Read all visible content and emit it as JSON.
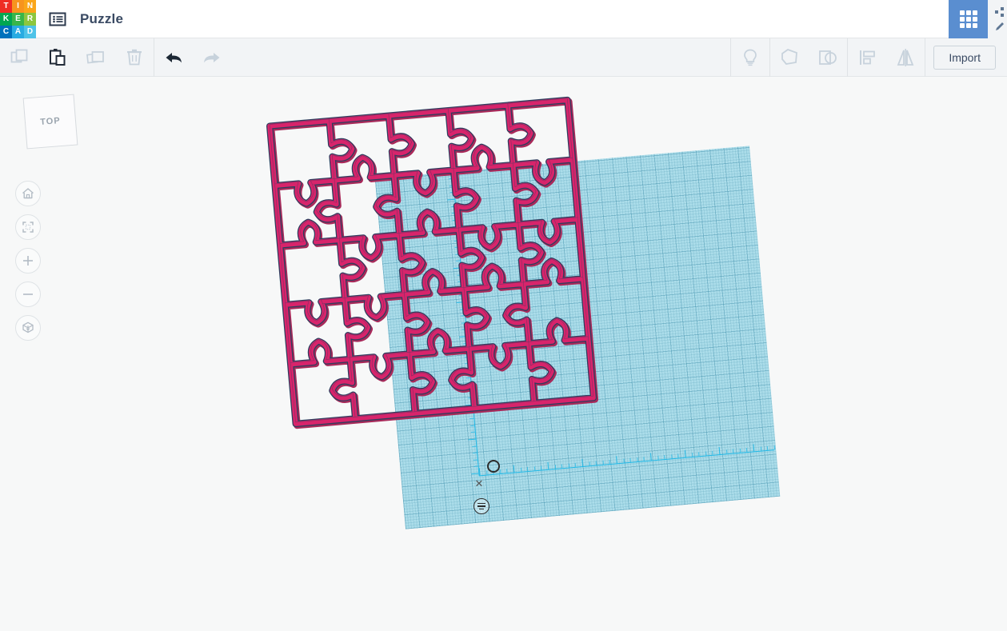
{
  "app": {
    "name": "Tinkercad",
    "logo_letters": [
      {
        "ch": "T",
        "color": "#ee2d24"
      },
      {
        "ch": "I",
        "color": "#f7941e"
      },
      {
        "ch": "N",
        "color": "#faa61a"
      },
      {
        "ch": "K",
        "color": "#00a651"
      },
      {
        "ch": "E",
        "color": "#39b54a"
      },
      {
        "ch": "R",
        "color": "#8dc63f"
      },
      {
        "ch": "C",
        "color": "#0071bc"
      },
      {
        "ch": "A",
        "color": "#29abe2"
      },
      {
        "ch": "D",
        "color": "#4fc3e8"
      }
    ],
    "accent_blue": "#5a8ed0"
  },
  "header": {
    "doc_menu_icon": "list-document-icon",
    "title": "Puzzle",
    "grid_button_icon": "grid-apps-icon",
    "edge_icons": [
      "share-icon",
      "edit-pencil-icon"
    ]
  },
  "toolbar": {
    "left_buttons": [
      {
        "name": "copy-button",
        "icon": "copy-icon",
        "label": "Copy",
        "enabled": false
      },
      {
        "name": "paste-button",
        "icon": "paste-icon",
        "label": "Paste",
        "enabled": true
      },
      {
        "name": "duplicate-button",
        "icon": "duplicate-icon",
        "label": "Duplicate",
        "enabled": false
      },
      {
        "name": "delete-button",
        "icon": "trash-icon",
        "label": "Delete",
        "enabled": false
      },
      {
        "name": "undo-button",
        "icon": "undo-arrow-icon",
        "label": "Undo",
        "enabled": true
      },
      {
        "name": "redo-button",
        "icon": "redo-arrow-icon",
        "label": "Redo",
        "enabled": false
      }
    ],
    "right_buttons": [
      {
        "name": "notes-button",
        "icon": "lightbulb-icon",
        "label": "Notes",
        "enabled": false
      },
      {
        "name": "group-button",
        "icon": "group-shapes-icon",
        "label": "Group",
        "enabled": false
      },
      {
        "name": "ungroup-button",
        "icon": "ungroup-shapes-icon",
        "label": "Ungroup",
        "enabled": false
      },
      {
        "name": "align-button",
        "icon": "align-icon",
        "label": "Align",
        "enabled": false
      },
      {
        "name": "mirror-button",
        "icon": "mirror-flip-icon",
        "label": "Mirror",
        "enabled": false
      }
    ],
    "import_label": "Import"
  },
  "canvas": {
    "background_color": "#f7f8f8",
    "viewcube": {
      "face_label": "TOP",
      "rotation_deg": -4.5
    },
    "nav_buttons": [
      {
        "name": "home-view-button",
        "icon": "home-icon",
        "label": "Home view"
      },
      {
        "name": "fit-view-button",
        "icon": "fit-to-view-icon",
        "label": "Fit all in view"
      },
      {
        "name": "zoom-in-button",
        "icon": "plus-icon",
        "label": "Zoom in"
      },
      {
        "name": "zoom-out-button",
        "icon": "minus-icon",
        "label": "Zoom out"
      },
      {
        "name": "projection-toggle-button",
        "icon": "ortho-perspective-cube-icon",
        "label": "Switch to orthographic/perspective view"
      }
    ],
    "workplane": {
      "fill_color": "#a9dcea",
      "grid_line_color": "#2b82a0",
      "rotation_deg": -5
    },
    "ruler": {
      "axis_color": "#15b5e5",
      "origin_icon": "ruler-origin-handle",
      "close_icon": "close-icon",
      "units_icon": "ruler-units-icon"
    },
    "model": {
      "name": "Puzzle",
      "shape": "jigsaw-puzzle-outline-grid",
      "rows": 5,
      "cols": 5,
      "rotation_deg": -5,
      "fill_color": "#d8246b",
      "shade_color": "#a82a5a",
      "outline_color": "#2d3e5e",
      "interior_color": "#ffffff"
    }
  }
}
